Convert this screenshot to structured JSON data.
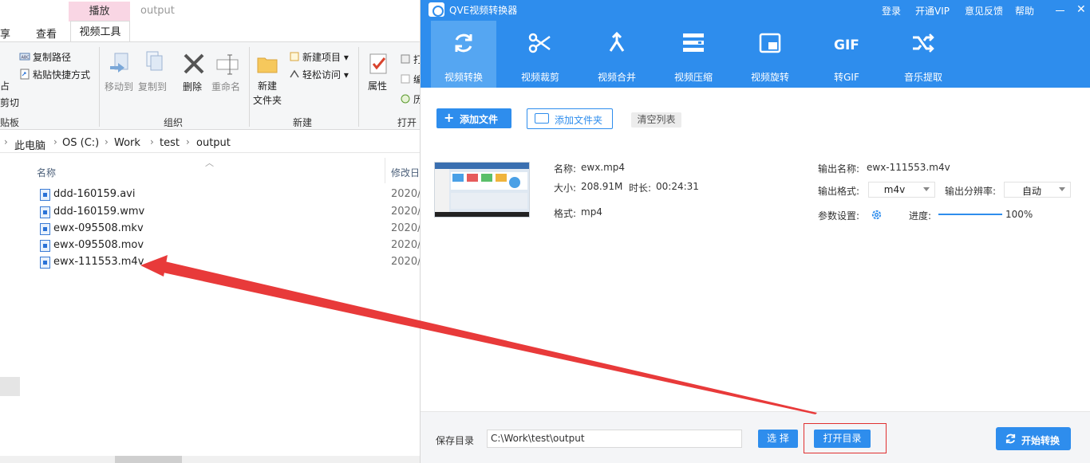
{
  "explorer": {
    "context_tab_header": "播放",
    "window_title": "output",
    "tabs": [
      {
        "label": "共享"
      },
      {
        "label": "查看"
      },
      {
        "label": "视频工具"
      }
    ],
    "partial_left": [
      "板",
      "剪切",
      "剪贴板"
    ],
    "ribbon": {
      "copy_path": "复制路径",
      "paste_shortcut": "粘贴快捷方式",
      "move_to": "移动到",
      "copy_to": "复制到",
      "delete": "删除",
      "rename": "重命名",
      "group_organize": "组织",
      "new_item": "新建项目",
      "easy_access": "轻松访问",
      "new_folder_line1": "新建",
      "new_folder_line2": "文件夹",
      "group_new": "新建",
      "properties": "属性",
      "group_open": "打开",
      "open_partial": "打",
      "edit_partial": "编",
      "history_partial": "历"
    },
    "breadcrumb": [
      "此电脑",
      "OS (C:)",
      "Work",
      "test",
      "output"
    ],
    "columns": {
      "name": "名称",
      "modified": "修改日"
    },
    "files": [
      {
        "name": "ddd-160159.avi",
        "date": "2020/"
      },
      {
        "name": "ddd-160159.wmv",
        "date": "2020/"
      },
      {
        "name": "ewx-095508.mkv",
        "date": "2020/"
      },
      {
        "name": "ewx-095508.mov",
        "date": "2020/"
      },
      {
        "name": "ewx-111553.m4v",
        "date": "2020/"
      }
    ]
  },
  "app": {
    "title": "QVE视频转换器",
    "top_links": [
      "登录",
      "开通VIP",
      "意见反馈",
      "帮助"
    ],
    "tools": [
      {
        "label": "视频转换",
        "icon": "convert-icon"
      },
      {
        "label": "视频裁剪",
        "icon": "scissors-icon"
      },
      {
        "label": "视频合并",
        "icon": "merge-icon"
      },
      {
        "label": "视频压缩",
        "icon": "compress-icon"
      },
      {
        "label": "视频旋转",
        "icon": "rotate-icon"
      },
      {
        "label": "转GIF",
        "icon": "gif-icon"
      },
      {
        "label": "音乐提取",
        "icon": "shuffle-icon"
      }
    ],
    "gif_text": "GIF",
    "add_file": "添加文件",
    "add_folder": "添加文件夹",
    "clear_list": "清空列表",
    "file": {
      "name_label": "名称:",
      "name": "ewx.mp4",
      "size_label": "大小:",
      "size": "208.91M",
      "duration_label": "时长:",
      "duration": "00:24:31",
      "format_label": "格式:",
      "format": "mp4",
      "output_name_label": "输出名称:",
      "output_name": "ewx-111553.m4v",
      "output_format_label": "输出格式:",
      "output_format": "m4v",
      "output_resolution_label": "输出分辨率:",
      "output_resolution": "自动",
      "params_label": "参数设置:",
      "progress_label": "进度:",
      "progress_text": "100%",
      "progress": 1.0
    },
    "save_dir_label": "保存目录",
    "save_dir_value": "C:\\Work\\test\\output",
    "choose": "选 择",
    "open_dir": "打开目录",
    "start": "开始转换"
  },
  "colors": {
    "accent": "#2e8ded",
    "annotation_red": "#e83a3a"
  }
}
